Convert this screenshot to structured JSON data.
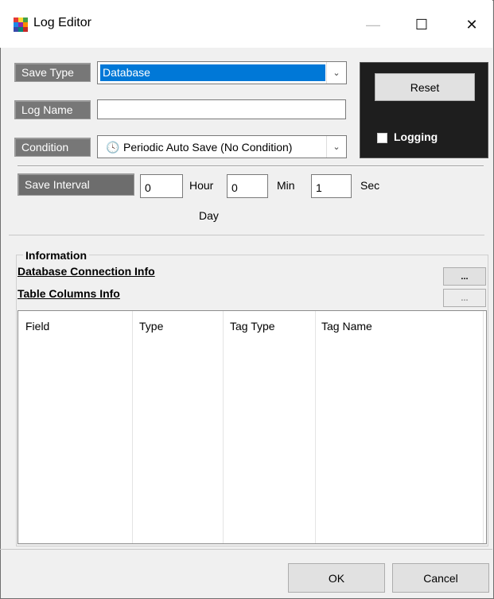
{
  "window": {
    "title": "Log Editor",
    "icon_colors": [
      "#e53935",
      "#fdd835",
      "#43a047",
      "#1e88e5",
      "#8e24aa",
      "#fb8c00",
      "#3949ab",
      "#00897b",
      "#c62828"
    ]
  },
  "controls": {
    "minimize": "—",
    "maximize": "☐",
    "close": "✕"
  },
  "form": {
    "save_type_label": "Save Type",
    "save_type_value": "Database",
    "log_name_label": "Log Name",
    "log_name_value": "",
    "condition_label": "Condition",
    "condition_value": "Periodic Auto Save (No Condition)",
    "save_interval_label": "Save Interval",
    "hour_value": "0",
    "hour_label": "Hour",
    "min_value": "0",
    "min_label": "Min",
    "sec_value": "1",
    "sec_label": "Sec",
    "day_label": "Day"
  },
  "side_panel": {
    "reset_label": "Reset",
    "logging_label": "Logging"
  },
  "info": {
    "group_title": "Information",
    "db_conn_link": "Database Connection Info",
    "db_conn_btn": "...",
    "table_cols_link": "Table Columns Info",
    "table_cols_btn": "..."
  },
  "table": {
    "columns": [
      "Field",
      "Type",
      "Tag Type",
      "Tag Name"
    ]
  },
  "footer": {
    "ok_label": "OK",
    "cancel_label": "Cancel"
  },
  "colors": {
    "accent_selection": "#0078d7",
    "label_bg": "#777777",
    "panel_bg": "#1e1e1e"
  }
}
